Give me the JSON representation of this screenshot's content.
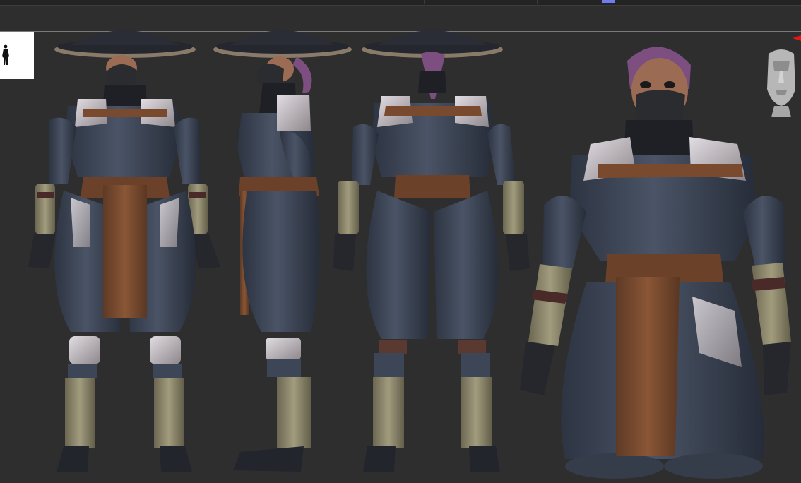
{
  "app": {
    "name": "sculpting-viewport",
    "accent_color": "#6f7cf0",
    "indicator_color": "#e01818"
  },
  "document": {
    "thumbnail": "character-silhouette-thumbnail",
    "navigator": "head-orientation-gizmo"
  },
  "colors": {
    "background": "#2e2e2e",
    "cloth": "#3d4656",
    "leather": "#7a4a2f",
    "armor": "#b9b3b8",
    "wraps": "#8c8669",
    "mask": "#2a2c30",
    "hat": "#24272e",
    "hair": "#7d4f80",
    "skin": "#9b6b53"
  },
  "views": [
    {
      "label": "front-view"
    },
    {
      "label": "side-view"
    },
    {
      "label": "back-view"
    },
    {
      "label": "closeup-view"
    }
  ]
}
